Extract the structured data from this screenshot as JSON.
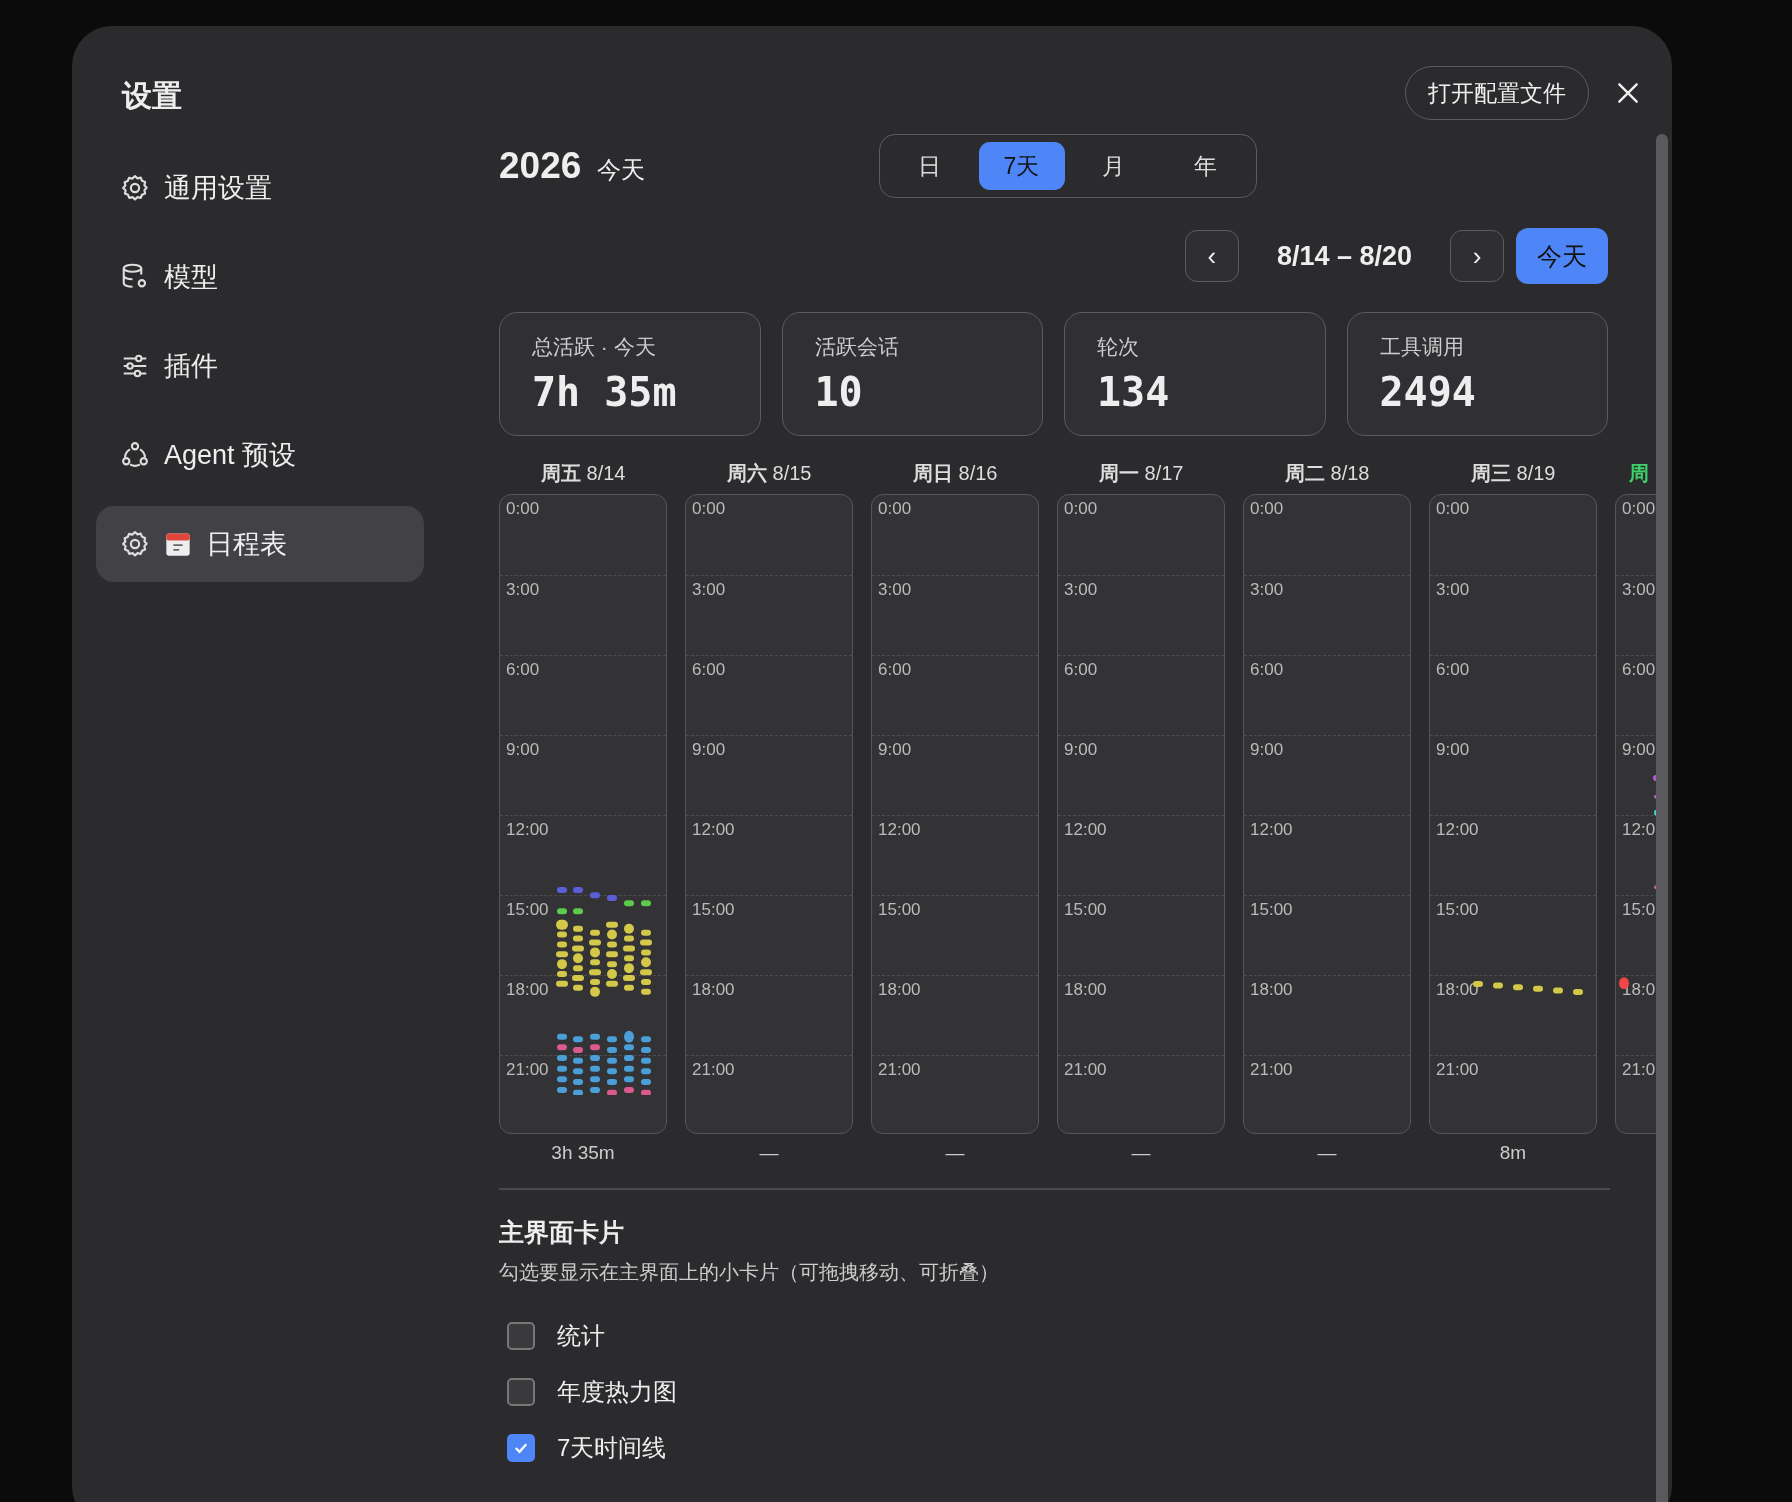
{
  "dialog": {
    "title": "设置",
    "open_config_button": "打开配置文件"
  },
  "sidebar": {
    "items": [
      {
        "label": "通用设置",
        "kind": "gear",
        "selected": false
      },
      {
        "label": "模型",
        "kind": "database",
        "selected": false
      },
      {
        "label": "插件",
        "kind": "sliders",
        "selected": false
      },
      {
        "label": "Agent 预设",
        "kind": "agent",
        "selected": false
      },
      {
        "label": "日程表",
        "kind": "schedule",
        "selected": true
      }
    ]
  },
  "header": {
    "year": "2026",
    "today_label": "今天"
  },
  "range_tabs": [
    {
      "label": "日",
      "selected": false
    },
    {
      "label": "7天",
      "selected": true
    },
    {
      "label": "月",
      "selected": false
    },
    {
      "label": "年",
      "selected": false
    }
  ],
  "navigation": {
    "prev": "‹",
    "range": "8/14 – 8/20",
    "next": "›",
    "today_button": "今天"
  },
  "stats": [
    {
      "label": "总活跃 · 今天",
      "value": "7h 35m"
    },
    {
      "label": "活跃会话",
      "value": "10"
    },
    {
      "label": "轮次",
      "value": "134"
    },
    {
      "label": "工具调用",
      "value": "2494"
    }
  ],
  "timeline": {
    "days": [
      {
        "weekday": "周五",
        "date": "8/14",
        "total": "3h 35m",
        "today": false,
        "hours": [
          "0:00",
          "3:00",
          "6:00",
          "9:00",
          "12:00",
          "15:00",
          "18:00",
          "21:00"
        ]
      },
      {
        "weekday": "周六",
        "date": "8/15",
        "total": "—",
        "today": false,
        "hours": [
          "0:00",
          "3:00",
          "6:00",
          "9:00",
          "12:00",
          "15:00",
          "18:00",
          "21:00"
        ]
      },
      {
        "weekday": "周日",
        "date": "8/16",
        "total": "—",
        "today": false,
        "hours": [
          "0:00",
          "3:00",
          "6:00",
          "9:00",
          "12:00",
          "15:00",
          "18:00",
          "21:00"
        ]
      },
      {
        "weekday": "周一",
        "date": "8/17",
        "total": "—",
        "today": false,
        "hours": [
          "0:00",
          "3:00",
          "6:00",
          "9:00",
          "12:00",
          "15:00",
          "18:00",
          "21:00"
        ]
      },
      {
        "weekday": "周二",
        "date": "8/18",
        "total": "—",
        "today": false,
        "hours": [
          "0:00",
          "3:00",
          "6:00",
          "9:00",
          "12:00",
          "15:00",
          "18:00",
          "21:00"
        ]
      },
      {
        "weekday": "周三",
        "date": "8/19",
        "total": "8m",
        "today": false,
        "hours": [
          "0:00",
          "3:00",
          "6:00",
          "9:00",
          "12:00",
          "15:00",
          "18:00",
          "21:00"
        ]
      },
      {
        "weekday": "周",
        "today": true,
        "hours": [
          "0:00",
          "3:00",
          "6:00",
          "9:00",
          "12:0",
          "15:0",
          "18:0",
          "21:0"
        ]
      }
    ]
  },
  "cards_section": {
    "title": "主界面卡片",
    "description": "勾选要显示在主界面上的小卡片（可拖拽移动、可折叠）",
    "options": [
      {
        "label": "统计",
        "checked": false
      },
      {
        "label": "年度热力图",
        "checked": false
      },
      {
        "label": "7天时间线",
        "checked": true
      }
    ]
  }
}
